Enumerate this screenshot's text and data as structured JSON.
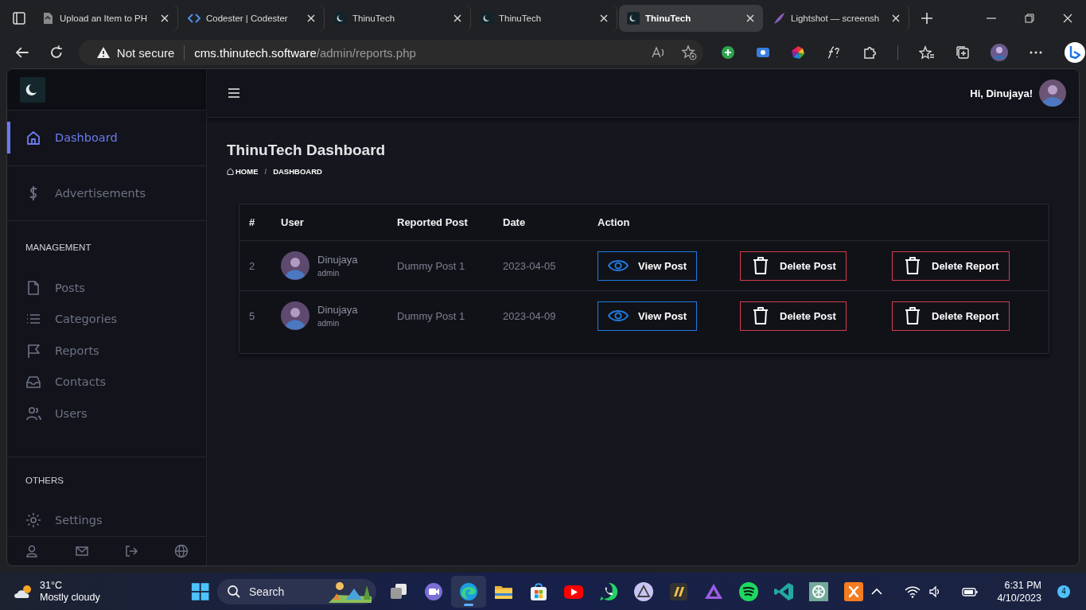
{
  "browser": {
    "tabs": [
      {
        "title": "Upload an Item to PH",
        "kind": "page",
        "selected": false
      },
      {
        "title": "Codester | Codester",
        "kind": "code",
        "selected": false
      },
      {
        "title": "ThinuTech",
        "kind": "moon",
        "selected": false
      },
      {
        "title": "ThinuTech",
        "kind": "moon",
        "selected": false
      },
      {
        "title": "ThinuTech",
        "kind": "moon",
        "selected": true
      },
      {
        "title": "Lightshot — screensh",
        "kind": "feather",
        "selected": false
      }
    ],
    "address": {
      "security": "Not secure",
      "host": "cms.thinutech.software",
      "path": "/admin/reports.php"
    }
  },
  "app": {
    "greeting": "Hi, Dinujaya!",
    "page_title": "ThinuTech Dashboard",
    "breadcrumb": [
      "HOME",
      "DASHBOARD"
    ],
    "breadcrumb_separator": "/",
    "sidebar": {
      "items": [
        {
          "label": "Dashboard",
          "kind": "home",
          "selected": true
        },
        {
          "label": "Advertisements",
          "kind": "dollar",
          "selected": false
        }
      ],
      "sections": [
        {
          "heading": "MANAGEMENT",
          "items": [
            {
              "label": "Posts",
              "kind": "file",
              "selected": false
            },
            {
              "label": "Categories",
              "kind": "list",
              "selected": false
            },
            {
              "label": "Reports",
              "kind": "flag",
              "selected": false
            },
            {
              "label": "Contacts",
              "kind": "inbox",
              "selected": false
            },
            {
              "label": "Users",
              "kind": "users",
              "selected": false
            }
          ]
        },
        {
          "heading": "OTHERS",
          "items": [
            {
              "label": "Settings",
              "kind": "gear",
              "selected": false
            }
          ]
        }
      ]
    },
    "table": {
      "columns": [
        "#",
        "User",
        "Reported Post",
        "Date",
        "Action"
      ],
      "rows": [
        {
          "number": "2",
          "user": "Dinujaya",
          "role": "admin",
          "post": "Dummy Post 1",
          "date": "2023-04-05",
          "actions": [
            {
              "label": "View Post",
              "kind": "view"
            },
            {
              "label": "Delete Post",
              "kind": "delete"
            },
            {
              "label": "Delete Report",
              "kind": "delete"
            }
          ]
        },
        {
          "number": "5",
          "user": "Dinujaya",
          "role": "admin",
          "post": "Dummy Post 1",
          "date": "2023-04-09",
          "actions": [
            {
              "label": "View Post",
              "kind": "view"
            },
            {
              "label": "Delete Post",
              "kind": "delete"
            },
            {
              "label": "Delete Report",
              "kind": "delete"
            }
          ]
        }
      ]
    }
  },
  "taskbar": {
    "weather": {
      "temperature": "31°C",
      "condition": "Mostly cloudy"
    },
    "search": {
      "placeholder": "Search"
    },
    "apps": [
      {
        "kind": "taskview",
        "selected": false
      },
      {
        "kind": "meet",
        "selected": false
      },
      {
        "kind": "edge",
        "selected": true
      },
      {
        "kind": "folder",
        "selected": false
      },
      {
        "kind": "store",
        "selected": false
      },
      {
        "kind": "video",
        "selected": false
      },
      {
        "kind": "chat",
        "selected": false
      },
      {
        "kind": "triangle",
        "selected": false
      },
      {
        "kind": "game",
        "selected": false
      },
      {
        "kind": "jelly",
        "selected": false
      },
      {
        "kind": "music",
        "selected": false
      },
      {
        "kind": "code",
        "selected": false
      },
      {
        "kind": "knot",
        "selected": false
      },
      {
        "kind": "xampp",
        "selected": false
      }
    ],
    "time": "6:31 PM",
    "date": "4/10/2023",
    "notifications": "4"
  }
}
